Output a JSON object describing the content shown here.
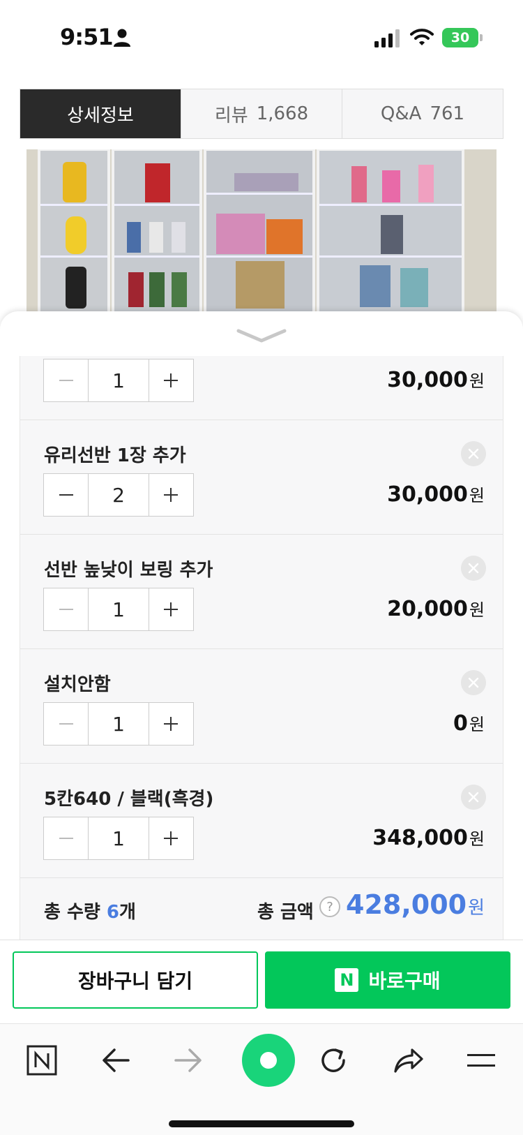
{
  "status": {
    "time": "9:51",
    "battery": "30"
  },
  "tabs": [
    {
      "label": "상세정보",
      "count": ""
    },
    {
      "label": "리뷰",
      "count": "1,668"
    },
    {
      "label": "Q&A",
      "count": "761"
    }
  ],
  "options": [
    {
      "name": "",
      "qty": "1",
      "price": "30,000",
      "unit": "원"
    },
    {
      "name": "유리선반 1장 추가",
      "qty": "2",
      "price": "30,000",
      "unit": "원"
    },
    {
      "name": "선반 높낮이 보링 추가",
      "qty": "1",
      "price": "20,000",
      "unit": "원"
    },
    {
      "name": "설치안함",
      "qty": "1",
      "price": "0",
      "unit": "원"
    },
    {
      "name": "5칸640 / 블랙(흑경)",
      "qty": "1",
      "price": "348,000",
      "unit": "원"
    }
  ],
  "total": {
    "qty_label": "총 수량",
    "qty": "6",
    "qty_unit": "개",
    "amount_label": "총 금액",
    "help": "?",
    "amount": "428,000",
    "unit": "원"
  },
  "actions": {
    "cart": "장바구니 담기",
    "buy": "바로구매",
    "buy_badge": "N"
  },
  "colors": {
    "naver_green": "#03c75a",
    "accent_blue": "#4a7de0",
    "tab_active": "#2a2a2a"
  },
  "toolbar": [
    "naver-home-icon",
    "back-arrow-icon",
    "forward-arrow-icon",
    "green-dot-icon",
    "reload-icon",
    "share-icon",
    "menu-icon"
  ]
}
